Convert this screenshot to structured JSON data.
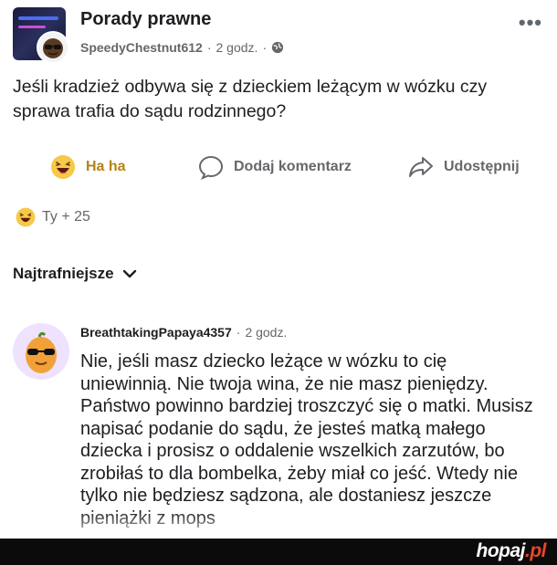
{
  "post": {
    "group_name": "Porady prawne",
    "author": "SpeedyChestnut612",
    "separator": "·",
    "time": "2 godz.",
    "text": "Jeśli kradzież odbywa się z dzieckiem leżącym w wózku czy sprawa trafia do sądu rodzinnego?"
  },
  "actions": {
    "haha_label": "Ha ha",
    "comment_label": "Dodaj komentarz",
    "share_label": "Udostępnij"
  },
  "reactions": {
    "summary": "Ty + 25"
  },
  "sort": {
    "label": "Najtrafniejsze"
  },
  "comment": {
    "author": "BreathtakingPapaya4357",
    "separator": "·",
    "time": "2 godz.",
    "text": "Nie, jeśli masz dziecko leżące w wózku to cię uniewinnią. Nie twoja wina, że nie masz pieniędzy. Państwo powinno bardziej troszczyć się o matki. Musisz napisać podanie do sądu, że jesteś matką małego dziecka i prosisz o oddalenie wszelkich zarzutów, bo zrobiłaś to dla bombelka, żeby miał co jeść. Wtedy nie tylko nie będziesz sądzona, ale dostaniesz jeszcze pieniążki z mops"
  },
  "watermark": {
    "main": "hopaj",
    "suffix": ".pl"
  },
  "icons": [
    "more-icon",
    "globe-icon",
    "haha-icon",
    "comment-bubble-icon",
    "share-arrow-icon",
    "chevron-down-icon"
  ],
  "colors": {
    "text": "#1c1e21",
    "muted": "#65676b",
    "haha": "#b58314",
    "footer": "#0b0b0b",
    "watermark_dot": "#e8462a"
  }
}
